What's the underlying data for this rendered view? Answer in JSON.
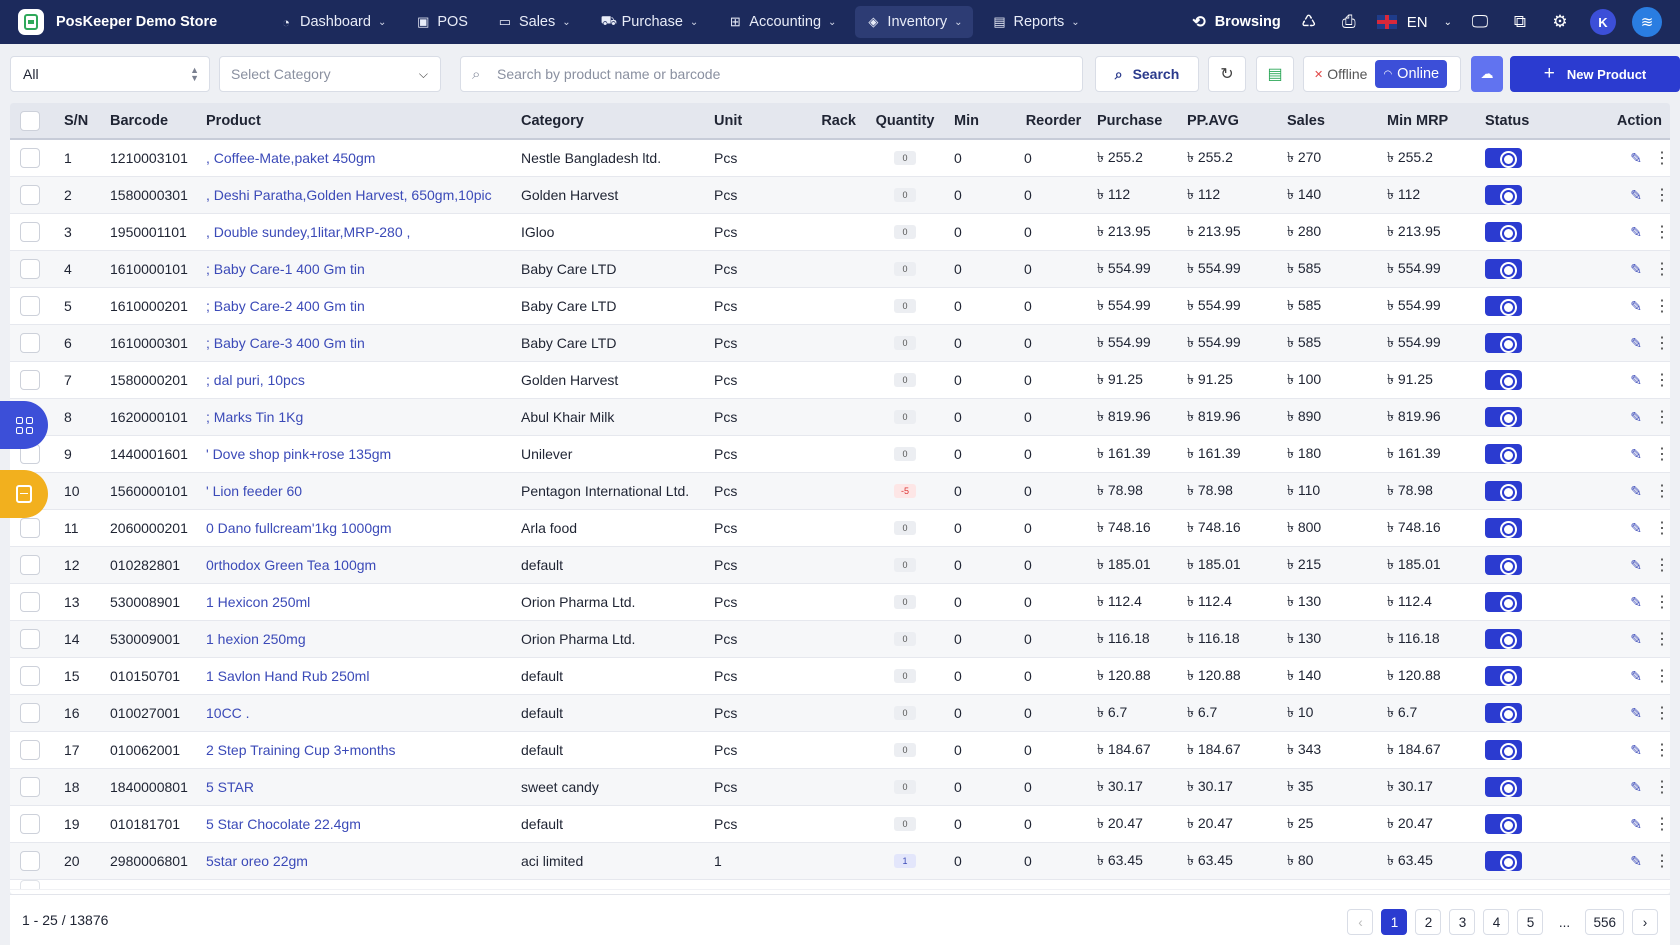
{
  "brand": {
    "name": "PosKeeper Demo Store"
  },
  "nav": {
    "items": [
      {
        "label": "Dashboard",
        "icon": "dashboard-icon",
        "caret": true
      },
      {
        "label": "POS",
        "icon": "pos-icon",
        "caret": false
      },
      {
        "label": "Sales",
        "icon": "sales-icon",
        "caret": true
      },
      {
        "label": "Purchase",
        "icon": "purchase-icon",
        "caret": true
      },
      {
        "label": "Accounting",
        "icon": "accounting-icon",
        "caret": true
      },
      {
        "label": "Inventory",
        "icon": "inventory-icon",
        "caret": true,
        "active": true
      },
      {
        "label": "Reports",
        "icon": "reports-icon",
        "caret": true
      }
    ],
    "browsing": "Browsing",
    "language": "EN",
    "avatar_initial": "K"
  },
  "filters": {
    "type_value": "All",
    "category_placeholder": "Select Category",
    "search_placeholder": "Search by product name or barcode",
    "search_button": "Search",
    "offline_label": "Offline",
    "online_label": "Online",
    "new_product_label": "New Product"
  },
  "table": {
    "headers": {
      "sn": "S/N",
      "barcode": "Barcode",
      "product": "Product",
      "category": "Category",
      "unit": "Unit",
      "rack": "Rack",
      "quantity": "Quantity",
      "min": "Min",
      "reorder": "Reorder",
      "purchase": "Purchase",
      "ppavg": "PP.AVG",
      "sales": "Sales",
      "minmrp": "Min MRP",
      "status": "Status",
      "action": "Action"
    },
    "rows": [
      {
        "sn": "1",
        "barcode": "1210003101",
        "product": ", Coffee-Mate,paket 450gm",
        "category": "Nestle Bangladesh ltd.",
        "unit": "Pcs",
        "rack": "",
        "quantity": "0",
        "min": "0",
        "reorder": "0",
        "purchase": "৳ 255.2",
        "ppavg": "৳ 255.2",
        "sales": "৳ 270",
        "minmrp": "৳ 255.2"
      },
      {
        "sn": "2",
        "barcode": "1580000301",
        "product": ", Deshi Paratha,Golden Harvest, 650gm,10pic",
        "category": "Golden Harvest",
        "unit": "Pcs",
        "rack": "",
        "quantity": "0",
        "min": "0",
        "reorder": "0",
        "purchase": "৳ 112",
        "ppavg": "৳ 112",
        "sales": "৳ 140",
        "minmrp": "৳ 112"
      },
      {
        "sn": "3",
        "barcode": "1950001101",
        "product": ", Double sundey,1litar,MRP-280 ,",
        "category": "IGloo",
        "unit": "Pcs",
        "rack": "",
        "quantity": "0",
        "min": "0",
        "reorder": "0",
        "purchase": "৳ 213.95",
        "ppavg": "৳ 213.95",
        "sales": "৳ 280",
        "minmrp": "৳ 213.95"
      },
      {
        "sn": "4",
        "barcode": "1610000101",
        "product": "; Baby Care-1 400 Gm tin",
        "category": "Baby Care LTD",
        "unit": "Pcs",
        "rack": "",
        "quantity": "0",
        "min": "0",
        "reorder": "0",
        "purchase": "৳ 554.99",
        "ppavg": "৳ 554.99",
        "sales": "৳ 585",
        "minmrp": "৳ 554.99"
      },
      {
        "sn": "5",
        "barcode": "1610000201",
        "product": "; Baby Care-2 400 Gm tin",
        "category": "Baby Care LTD",
        "unit": "Pcs",
        "rack": "",
        "quantity": "0",
        "min": "0",
        "reorder": "0",
        "purchase": "৳ 554.99",
        "ppavg": "৳ 554.99",
        "sales": "৳ 585",
        "minmrp": "৳ 554.99"
      },
      {
        "sn": "6",
        "barcode": "1610000301",
        "product": "; Baby Care-3 400 Gm tin",
        "category": "Baby Care LTD",
        "unit": "Pcs",
        "rack": "",
        "quantity": "0",
        "min": "0",
        "reorder": "0",
        "purchase": "৳ 554.99",
        "ppavg": "৳ 554.99",
        "sales": "৳ 585",
        "minmrp": "৳ 554.99"
      },
      {
        "sn": "7",
        "barcode": "1580000201",
        "product": "; dal puri, 10pcs",
        "category": "Golden Harvest",
        "unit": "Pcs",
        "rack": "",
        "quantity": "0",
        "min": "0",
        "reorder": "0",
        "purchase": "৳ 91.25",
        "ppavg": "৳ 91.25",
        "sales": "৳ 100",
        "minmrp": "৳ 91.25"
      },
      {
        "sn": "8",
        "barcode": "1620000101",
        "product": "; Marks Tin 1Kg",
        "category": "Abul Khair Milk",
        "unit": "Pcs",
        "rack": "",
        "quantity": "0",
        "min": "0",
        "reorder": "0",
        "purchase": "৳ 819.96",
        "ppavg": "৳ 819.96",
        "sales": "৳ 890",
        "minmrp": "৳ 819.96"
      },
      {
        "sn": "9",
        "barcode": "1440001601",
        "product": "' Dove shop pink+rose 135gm",
        "category": "Unilever",
        "unit": "Pcs",
        "rack": "",
        "quantity": "0",
        "min": "0",
        "reorder": "0",
        "purchase": "৳ 161.39",
        "ppavg": "৳ 161.39",
        "sales": "৳ 180",
        "minmrp": "৳ 161.39"
      },
      {
        "sn": "10",
        "barcode": "1560000101",
        "product": "' Lion feeder 60",
        "category": "Pentagon International Ltd.",
        "unit": "Pcs",
        "rack": "",
        "quantity": "-5",
        "min": "0",
        "reorder": "0",
        "purchase": "৳ 78.98",
        "ppavg": "৳ 78.98",
        "sales": "৳ 110",
        "minmrp": "৳ 78.98"
      },
      {
        "sn": "11",
        "barcode": "2060000201",
        "product": "0 Dano fullcream'1kg 1000gm",
        "category": "Arla food",
        "unit": "Pcs",
        "rack": "",
        "quantity": "0",
        "min": "0",
        "reorder": "0",
        "purchase": "৳ 748.16",
        "ppavg": "৳ 748.16",
        "sales": "৳ 800",
        "minmrp": "৳ 748.16"
      },
      {
        "sn": "12",
        "barcode": "010282801",
        "product": "0rthodox Green Tea 100gm",
        "category": "default",
        "unit": "Pcs",
        "rack": "",
        "quantity": "0",
        "min": "0",
        "reorder": "0",
        "purchase": "৳ 185.01",
        "ppavg": "৳ 185.01",
        "sales": "৳ 215",
        "minmrp": "৳ 185.01"
      },
      {
        "sn": "13",
        "barcode": "530008901",
        "product": "1 Hexicon 250ml",
        "category": "Orion Pharma Ltd.",
        "unit": "Pcs",
        "rack": "",
        "quantity": "0",
        "min": "0",
        "reorder": "0",
        "purchase": "৳ 112.4",
        "ppavg": "৳ 112.4",
        "sales": "৳ 130",
        "minmrp": "৳ 112.4"
      },
      {
        "sn": "14",
        "barcode": "530009001",
        "product": "1 hexion 250mg",
        "category": "Orion Pharma Ltd.",
        "unit": "Pcs",
        "rack": "",
        "quantity": "0",
        "min": "0",
        "reorder": "0",
        "purchase": "৳ 116.18",
        "ppavg": "৳ 116.18",
        "sales": "৳ 130",
        "minmrp": "৳ 116.18"
      },
      {
        "sn": "15",
        "barcode": "010150701",
        "product": "1 Savlon Hand Rub 250ml",
        "category": "default",
        "unit": "Pcs",
        "rack": "",
        "quantity": "0",
        "min": "0",
        "reorder": "0",
        "purchase": "৳ 120.88",
        "ppavg": "৳ 120.88",
        "sales": "৳ 140",
        "minmrp": "৳ 120.88"
      },
      {
        "sn": "16",
        "barcode": "010027001",
        "product": "10CC .",
        "category": "default",
        "unit": "Pcs",
        "rack": "",
        "quantity": "0",
        "min": "0",
        "reorder": "0",
        "purchase": "৳ 6.7",
        "ppavg": "৳ 6.7",
        "sales": "৳ 10",
        "minmrp": "৳ 6.7"
      },
      {
        "sn": "17",
        "barcode": "010062001",
        "product": "2 Step Training Cup 3+months",
        "category": "default",
        "unit": "Pcs",
        "rack": "",
        "quantity": "0",
        "min": "0",
        "reorder": "0",
        "purchase": "৳ 184.67",
        "ppavg": "৳ 184.67",
        "sales": "৳ 343",
        "minmrp": "৳ 184.67"
      },
      {
        "sn": "18",
        "barcode": "1840000801",
        "product": "5 STAR",
        "category": "sweet candy",
        "unit": "Pcs",
        "rack": "",
        "quantity": "0",
        "min": "0",
        "reorder": "0",
        "purchase": "৳ 30.17",
        "ppavg": "৳ 30.17",
        "sales": "৳ 35",
        "minmrp": "৳ 30.17"
      },
      {
        "sn": "19",
        "barcode": "010181701",
        "product": "5 Star Chocolate 22.4gm",
        "category": "default",
        "unit": "Pcs",
        "rack": "",
        "quantity": "0",
        "min": "0",
        "reorder": "0",
        "purchase": "৳ 20.47",
        "ppavg": "৳ 20.47",
        "sales": "৳ 25",
        "minmrp": "৳ 20.47"
      },
      {
        "sn": "20",
        "barcode": "2980006801",
        "product": "5star oreo 22gm",
        "category": "aci limited",
        "unit": "1",
        "rack": "",
        "quantity": "1",
        "min": "0",
        "reorder": "0",
        "purchase": "৳ 63.45",
        "ppavg": "৳ 63.45",
        "sales": "৳ 80",
        "minmrp": "৳ 63.45"
      }
    ]
  },
  "footer": {
    "range": "1 - 25 / 13876",
    "pages": [
      "1",
      "2",
      "3",
      "4",
      "5"
    ],
    "ellipsis": "...",
    "last_page": "556",
    "current_page": "1"
  },
  "colors": {
    "nav_bg": "#1c2a5c",
    "accent": "#2b3bd0",
    "link": "#3b4ab8",
    "float_yellow": "#f2b01e",
    "danger": "#dd3333"
  }
}
